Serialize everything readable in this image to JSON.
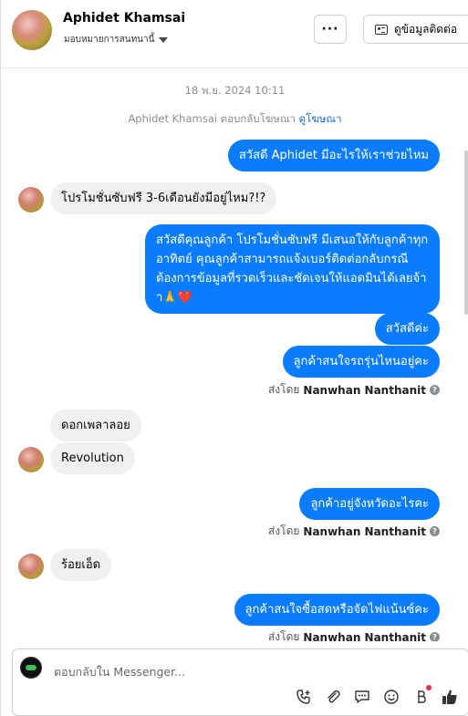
{
  "header": {
    "name": "Aphidet Khamsai",
    "assign_label": "มอบหมายการสนทนานี้",
    "more_label": "···",
    "contact_label": "ดูข้อมูลติดต่อ"
  },
  "chat": {
    "timestamp": "18 พ.ย. 2024 10:11",
    "ad_reply_text": "Aphidet Khamsai ตอบกลับโฆษณา",
    "ad_link": "ดูโฆษณา",
    "messages": [
      {
        "from": "page",
        "text": "สวัสดี Aphidet มีอะไรให้เราช่วยไหม"
      },
      {
        "from": "user",
        "text": "โปรโมชั่นซับฟรี 3-6เดือนยังมีอยู่ไหม?!?"
      },
      {
        "from": "page",
        "text": "สวัสดีคุณลูกค้า โปรโมชั่นซับฟรี มีเสนอให้กับลูกค้าทุกอาทิตย์ คุณลูกค้าสามารถแจ้งเบอร์ติดต่อกลับกรณีต้องการข้อมูลที่รวดเร็วและชัดเจนให้แอดมินได้เลยจ้าา🙏"
      },
      {
        "from": "page",
        "text": "สวัสดีค่ะ"
      },
      {
        "from": "page",
        "text": "ลูกค้าสนใจรถรุ่นไหนอยู่คะ"
      },
      {
        "from": "user",
        "text": "ดอกเพลาลอย"
      },
      {
        "from": "user",
        "text": "Revolution"
      },
      {
        "from": "page",
        "text": "ลูกค้าอยู่จังหวัดอะไรคะ"
      },
      {
        "from": "user",
        "text": "ร้อยเอ็ด"
      },
      {
        "from": "page",
        "text": "ลูกค้าสนใจซื้อสดหรือจัดไฟแน้นซ์คะ"
      }
    ],
    "heart": "❤️",
    "sent_by_label": "ส่งโดย",
    "sent_by_name": "Nanwhan Nanthanit",
    "help_mark": "?"
  },
  "composer": {
    "placeholder": "ตอบกลับใน Messenger..."
  }
}
